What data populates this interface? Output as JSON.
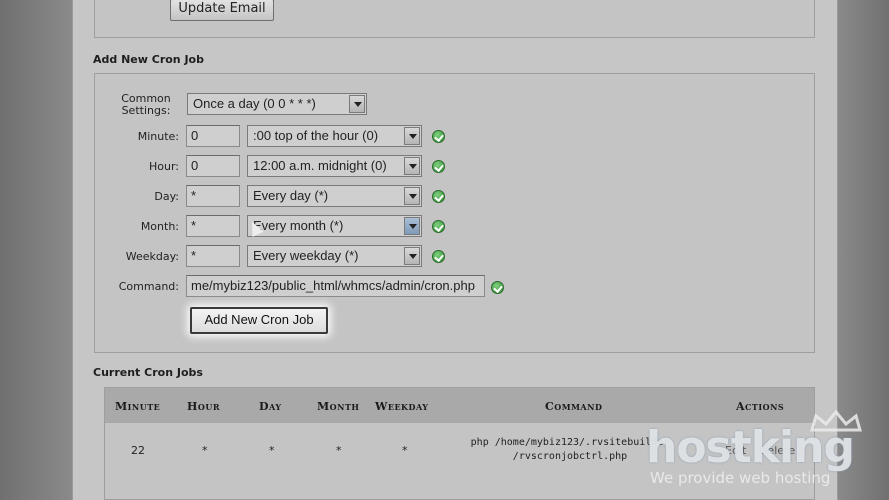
{
  "top": {
    "update_email_label": "Update Email"
  },
  "add_section": {
    "title": "Add New Cron Job",
    "common_settings_label": "Common Settings:",
    "common_settings_value": "Once a day (0 0 * * *)",
    "rows": [
      {
        "label": "Minute:",
        "value": "0",
        "select": ":00 top of the hour (0)"
      },
      {
        "label": "Hour:",
        "value": "0",
        "select": "12:00 a.m. midnight (0)"
      },
      {
        "label": "Day:",
        "value": "*",
        "select": "Every day (*)"
      },
      {
        "label": "Month:",
        "value": "*",
        "select": "Every month (*)"
      },
      {
        "label": "Weekday:",
        "value": "*",
        "select": "Every weekday (*)"
      }
    ],
    "command_label": "Command:",
    "command_value": "me/mybiz123/public_html/whmcs/admin/cron.php",
    "submit_label": "Add New Cron Job"
  },
  "current_section": {
    "title": "Current Cron Jobs",
    "headers": [
      "Minute",
      "Hour",
      "Day",
      "Month",
      "Weekday",
      "Command",
      "Actions"
    ],
    "rows": [
      {
        "minute": "22",
        "hour": "*",
        "day": "*",
        "month": "*",
        "weekday": "*",
        "command_line1": "php /home/mybiz123/.rvsitebuilder",
        "command_line2": "/rvscronjobctrl.php",
        "edit": "Edit",
        "delete": "Delete"
      }
    ]
  },
  "watermark": {
    "brand": "hostking",
    "tagline": "We provide web hosting"
  },
  "colors": {
    "page": "#c6c6c6",
    "check_green": "#2e8a2e",
    "dropdown_active": "#7f9ab8"
  }
}
